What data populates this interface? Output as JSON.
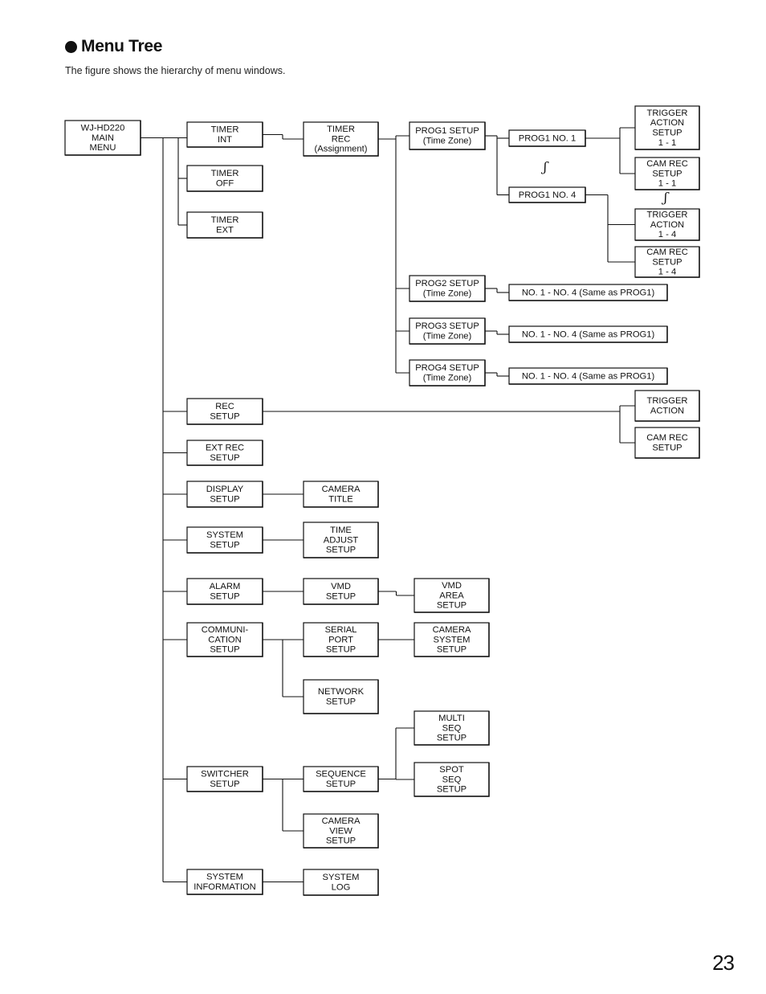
{
  "header": {
    "title": "Menu Tree",
    "subtitle": "The figure shows the hierarchy of menu windows."
  },
  "page_number": "23",
  "ellipsis_glyph": "ʃ",
  "nodes": [
    {
      "id": "main",
      "lines": [
        "WJ-HD220",
        "MAIN",
        "MENU"
      ],
      "root": true
    },
    {
      "id": "timer-int",
      "lines": [
        "TIMER",
        "INT"
      ]
    },
    {
      "id": "timer-off",
      "lines": [
        "TIMER",
        "OFF"
      ]
    },
    {
      "id": "timer-ext",
      "lines": [
        "TIMER",
        "EXT"
      ]
    },
    {
      "id": "timer-rec",
      "lines": [
        "TIMER",
        "REC",
        "(Assignment)"
      ]
    },
    {
      "id": "prog1-setup",
      "lines": [
        "PROG1 SETUP",
        "(Time Zone)"
      ]
    },
    {
      "id": "prog1-no1",
      "lines": [
        "PROG1 NO. 1"
      ]
    },
    {
      "id": "prog1-no4",
      "lines": [
        "PROG1 NO. 4"
      ]
    },
    {
      "id": "trigger-1-1",
      "lines": [
        "TRIGGER",
        "ACTION",
        "SETUP",
        "1 - 1"
      ]
    },
    {
      "id": "camrec-1-1",
      "lines": [
        "CAM REC",
        "SETUP",
        "1 - 1"
      ]
    },
    {
      "id": "trigger-1-4",
      "lines": [
        "TRIGGER",
        "ACTION",
        "1 - 4"
      ]
    },
    {
      "id": "camrec-1-4",
      "lines": [
        "CAM REC",
        "SETUP",
        "1 - 4"
      ]
    },
    {
      "id": "prog2-setup",
      "lines": [
        "PROG2 SETUP",
        "(Time Zone)"
      ]
    },
    {
      "id": "prog2-same",
      "lines": [
        "NO. 1 - NO. 4 (Same as PROG1)"
      ]
    },
    {
      "id": "prog3-setup",
      "lines": [
        "PROG3 SETUP",
        "(Time Zone)"
      ]
    },
    {
      "id": "prog3-same",
      "lines": [
        "NO. 1 - NO. 4 (Same as PROG1)"
      ]
    },
    {
      "id": "prog4-setup",
      "lines": [
        "PROG4 SETUP",
        "(Time Zone)"
      ]
    },
    {
      "id": "prog4-same",
      "lines": [
        "NO. 1 - NO. 4 (Same as PROG1)"
      ]
    },
    {
      "id": "rec-setup",
      "lines": [
        "REC",
        "SETUP"
      ]
    },
    {
      "id": "trigger-action",
      "lines": [
        "TRIGGER",
        "ACTION"
      ]
    },
    {
      "id": "cam-rec-setup",
      "lines": [
        "CAM REC",
        "SETUP"
      ]
    },
    {
      "id": "ext-rec-setup",
      "lines": [
        "EXT REC",
        "SETUP"
      ]
    },
    {
      "id": "display-setup",
      "lines": [
        "DISPLAY",
        "SETUP"
      ]
    },
    {
      "id": "camera-title",
      "lines": [
        "CAMERA",
        "TITLE"
      ]
    },
    {
      "id": "system-setup",
      "lines": [
        "SYSTEM",
        "SETUP"
      ]
    },
    {
      "id": "time-adjust-setup",
      "lines": [
        "TIME",
        "ADJUST",
        "SETUP"
      ]
    },
    {
      "id": "alarm-setup",
      "lines": [
        "ALARM",
        "SETUP"
      ]
    },
    {
      "id": "vmd-setup",
      "lines": [
        "VMD",
        "SETUP"
      ]
    },
    {
      "id": "vmd-area-setup",
      "lines": [
        "VMD",
        "AREA",
        "SETUP"
      ]
    },
    {
      "id": "communication-setup",
      "lines": [
        "COMMUNI-",
        "CATION",
        "SETUP"
      ]
    },
    {
      "id": "serial-port-setup",
      "lines": [
        "SERIAL",
        "PORT",
        "SETUP"
      ]
    },
    {
      "id": "camera-system-setup",
      "lines": [
        "CAMERA",
        "SYSTEM",
        "SETUP"
      ]
    },
    {
      "id": "network-setup",
      "lines": [
        "NETWORK",
        "SETUP"
      ]
    },
    {
      "id": "switcher-setup",
      "lines": [
        "SWITCHER",
        "SETUP"
      ]
    },
    {
      "id": "sequence-setup",
      "lines": [
        "SEQUENCE",
        "SETUP"
      ]
    },
    {
      "id": "multi-seq-setup",
      "lines": [
        "MULTI",
        "SEQ",
        "SETUP"
      ]
    },
    {
      "id": "spot-seq-setup",
      "lines": [
        "SPOT",
        "SEQ",
        "SETUP"
      ]
    },
    {
      "id": "camera-view-setup",
      "lines": [
        "CAMERA",
        "VIEW",
        "SETUP"
      ]
    },
    {
      "id": "system-information",
      "lines": [
        "SYSTEM",
        "INFORMATION"
      ]
    },
    {
      "id": "system-log",
      "lines": [
        "SYSTEM",
        "LOG"
      ]
    }
  ],
  "edges": [
    [
      "main",
      "timer-int"
    ],
    [
      "main",
      "timer-off"
    ],
    [
      "main",
      "timer-ext"
    ],
    [
      "timer-int",
      "timer-rec"
    ],
    [
      "timer-rec",
      "prog1-setup"
    ],
    [
      "timer-rec",
      "prog2-setup"
    ],
    [
      "timer-rec",
      "prog3-setup"
    ],
    [
      "timer-rec",
      "prog4-setup"
    ],
    [
      "prog1-setup",
      "prog1-no1"
    ],
    [
      "prog1-setup",
      "prog1-no4"
    ],
    [
      "prog1-no1",
      "trigger-1-1"
    ],
    [
      "prog1-no1",
      "camrec-1-1"
    ],
    [
      "prog1-no4",
      "trigger-1-4"
    ],
    [
      "prog1-no4",
      "camrec-1-4"
    ],
    [
      "prog2-setup",
      "prog2-same"
    ],
    [
      "prog3-setup",
      "prog3-same"
    ],
    [
      "prog4-setup",
      "prog4-same"
    ],
    [
      "main",
      "rec-setup"
    ],
    [
      "rec-setup",
      "trigger-action"
    ],
    [
      "rec-setup",
      "cam-rec-setup"
    ],
    [
      "main",
      "ext-rec-setup"
    ],
    [
      "main",
      "display-setup"
    ],
    [
      "display-setup",
      "camera-title"
    ],
    [
      "main",
      "system-setup"
    ],
    [
      "system-setup",
      "time-adjust-setup"
    ],
    [
      "main",
      "alarm-setup"
    ],
    [
      "alarm-setup",
      "vmd-setup"
    ],
    [
      "vmd-setup",
      "vmd-area-setup"
    ],
    [
      "main",
      "communication-setup"
    ],
    [
      "communication-setup",
      "serial-port-setup"
    ],
    [
      "serial-port-setup",
      "camera-system-setup"
    ],
    [
      "communication-setup",
      "network-setup"
    ],
    [
      "main",
      "switcher-setup"
    ],
    [
      "switcher-setup",
      "sequence-setup"
    ],
    [
      "sequence-setup",
      "multi-seq-setup"
    ],
    [
      "sequence-setup",
      "spot-seq-setup"
    ],
    [
      "switcher-setup",
      "camera-view-setup"
    ],
    [
      "main",
      "system-information"
    ],
    [
      "system-information",
      "system-log"
    ]
  ]
}
